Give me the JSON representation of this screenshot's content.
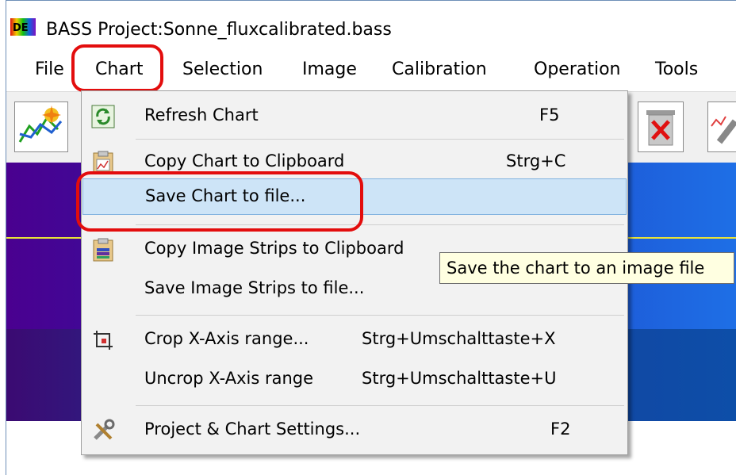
{
  "window": {
    "title": "BASS Project:Sonne_fluxcalibrated.bass"
  },
  "menubar": {
    "items": [
      "File",
      "Chart",
      "Selection",
      "Image",
      "Calibration",
      "Operation",
      "Tools"
    ]
  },
  "dropdown": {
    "items": [
      {
        "label": "Refresh Chart",
        "shortcut": "F5",
        "icon": "refresh-icon"
      },
      {
        "label": "Copy Chart to Clipboard",
        "shortcut": "Strg+C",
        "icon": "clipboard-chart-icon"
      },
      {
        "label": "Save Chart to file...",
        "shortcut": "",
        "icon": ""
      },
      {
        "label": "Copy Image Strips to Clipboard",
        "shortcut": "",
        "icon": "clipboard-strips-icon"
      },
      {
        "label": "Save Image Strips to file...",
        "shortcut": "",
        "icon": ""
      },
      {
        "label": "Crop X-Axis range...",
        "shortcut": "Strg+Umschalttaste+X",
        "icon": "crop-icon"
      },
      {
        "label": "Uncrop X-Axis range",
        "shortcut": "Strg+Umschalttaste+U",
        "icon": ""
      },
      {
        "label": "Project & Chart Settings...",
        "shortcut": "F2",
        "icon": "settings-tools-icon"
      }
    ]
  },
  "tooltip": {
    "text": "Save the chart to an image file"
  },
  "colors": {
    "highlight_red": "#e30d0d",
    "selection_blue": "#cde4f7",
    "tooltip_bg": "#ffffe1"
  }
}
